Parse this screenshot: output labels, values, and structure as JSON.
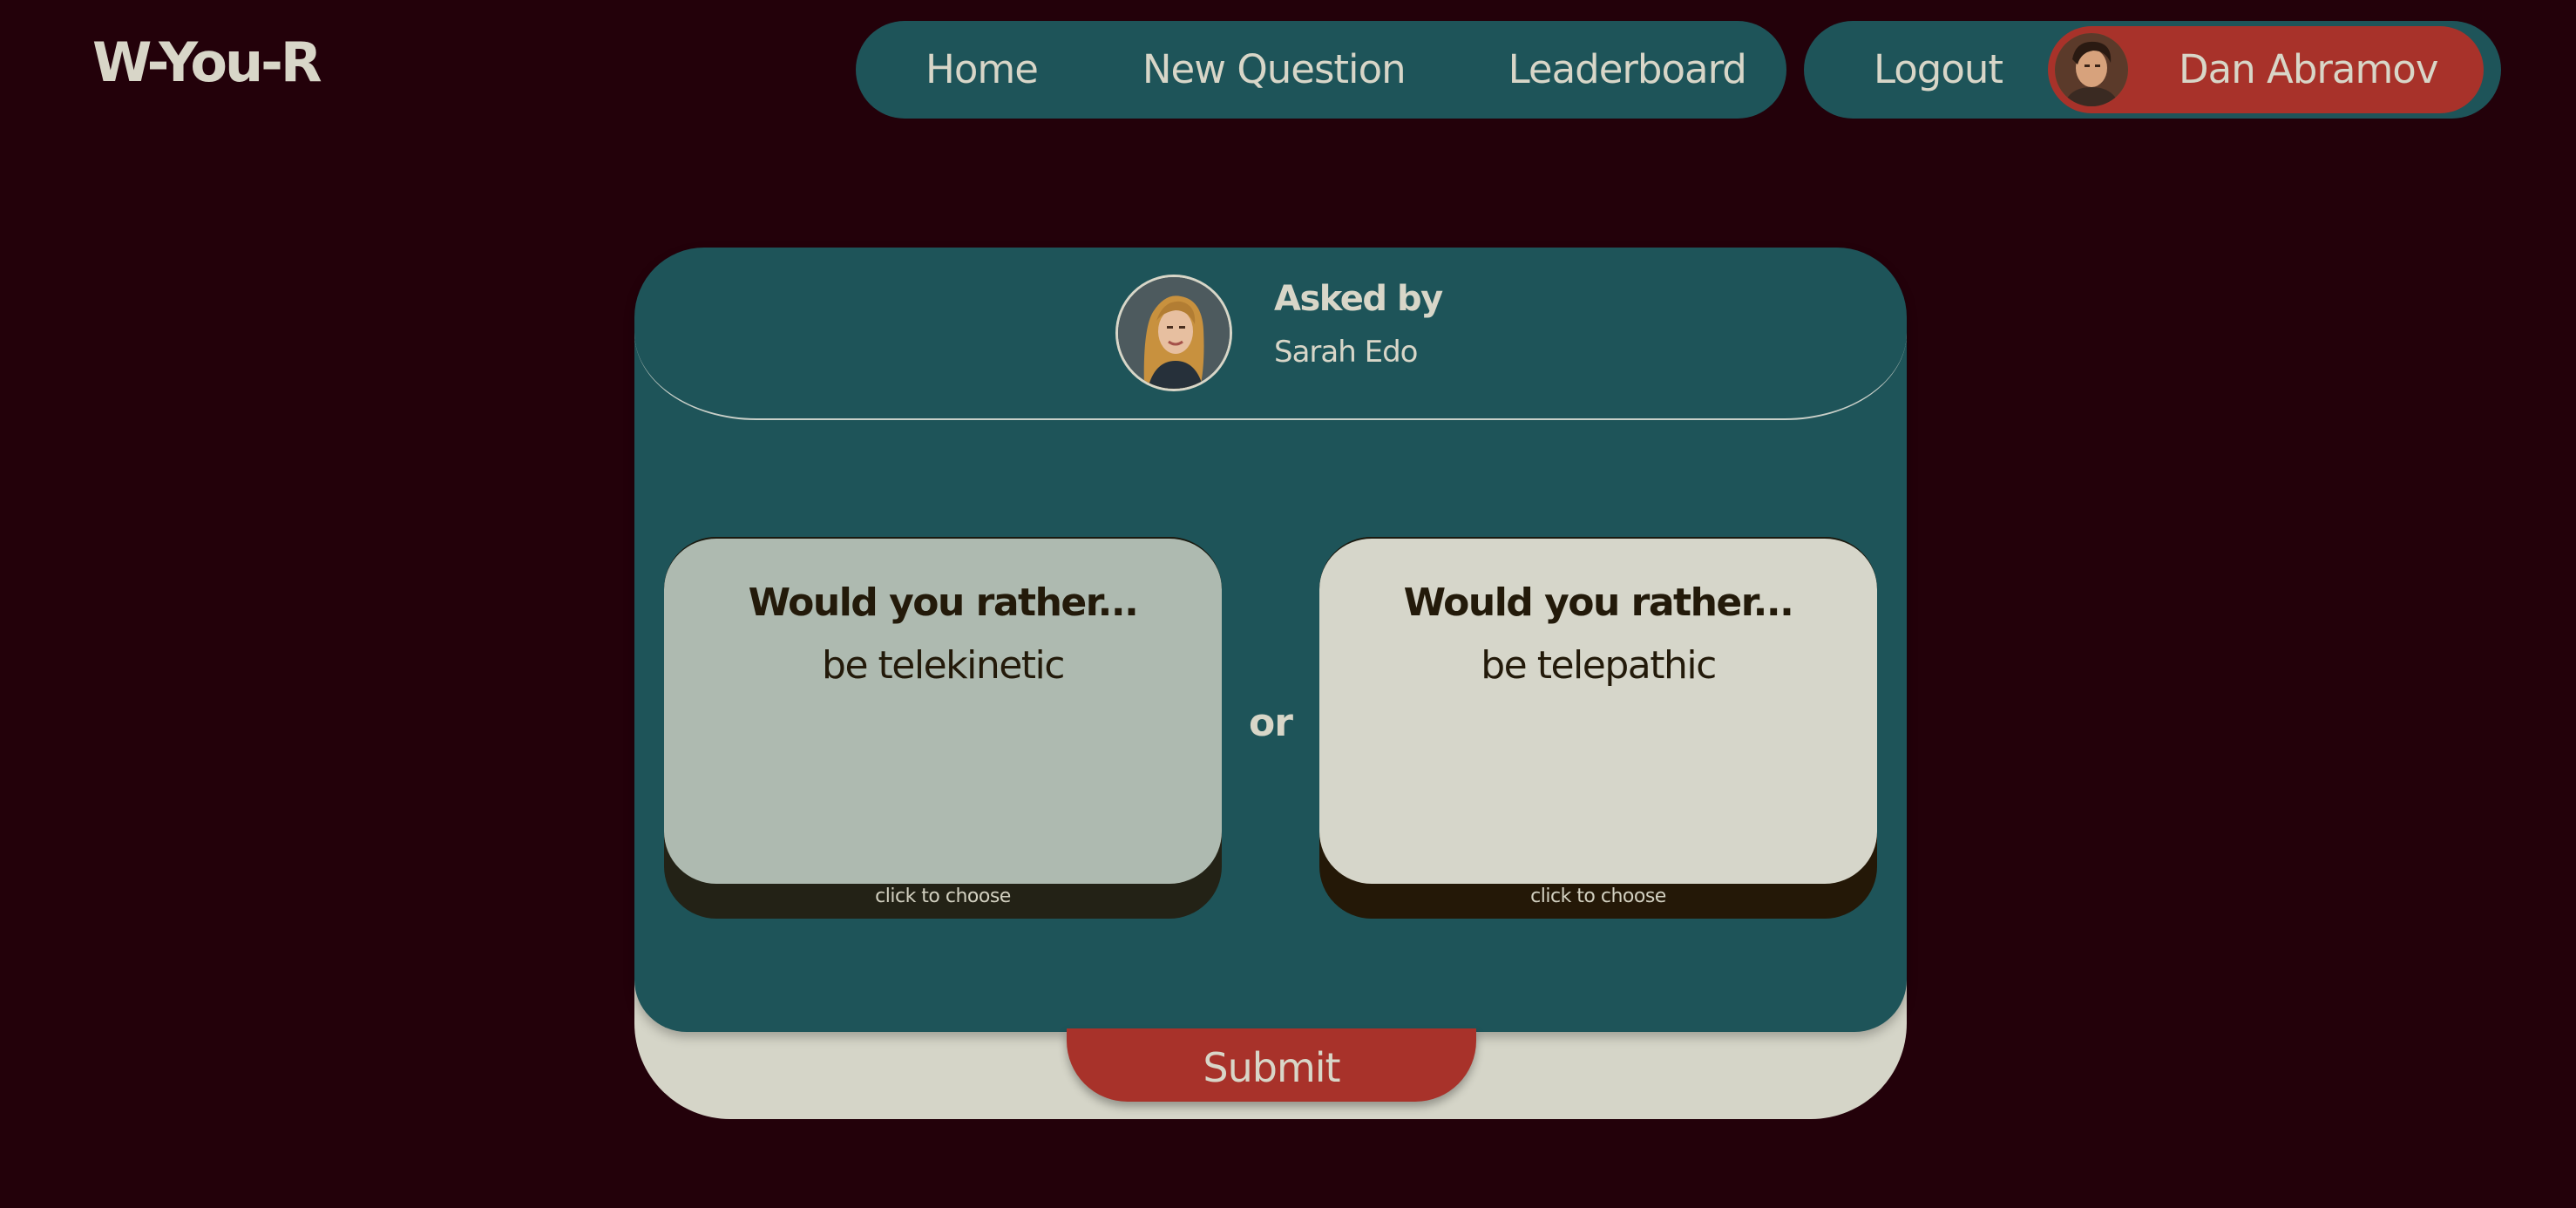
{
  "logo": {
    "text": "W-You-R"
  },
  "nav": {
    "home_label": "Home",
    "new_question_label": "New Question",
    "leaderboard_label": "Leaderboard"
  },
  "user_nav": {
    "logout_label": "Logout",
    "user_name": "Dan Abramov"
  },
  "question": {
    "asked_by_label": "Asked by",
    "author_name": "Sarah Edo",
    "or_label": "or",
    "options": [
      {
        "title": "Would you rather...",
        "text": "be telekinetic",
        "hint": "click to choose"
      },
      {
        "title": "Would you rather...",
        "text": "be telepathic",
        "hint": "click to choose"
      }
    ],
    "submit_label": "Submit"
  },
  "colors": {
    "background": "#23010a",
    "teal": "#1e5459",
    "red_accent": "#a8322a",
    "cream": "#d5d5c8",
    "option_selected": "#aebab0",
    "text_light": "#d8d6c8",
    "text_dark": "#231a0a"
  }
}
